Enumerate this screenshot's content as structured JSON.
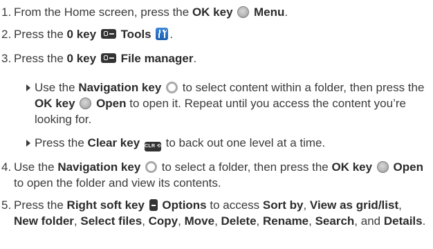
{
  "steps": [
    {
      "num": "1.",
      "a": "From the Home screen, press the ",
      "b1": "OK key",
      "c": " ",
      "b2": "Menu",
      "d": "."
    },
    {
      "num": "2.",
      "a": "Press the ",
      "b1": "0 key",
      "c": " ",
      "b2": "Tools",
      "d": "."
    },
    {
      "num": "3.",
      "a": "Press the ",
      "b1": "0 key",
      "c": " ",
      "b2": "File manager",
      "d": "."
    },
    {
      "num": "4.",
      "a": "Use the ",
      "b1": "Navigation key",
      "c": " to select a folder, then press the ",
      "b2": "OK key",
      "b3": "Open",
      "d": " to open the folder and view its contents."
    },
    {
      "num": "5.",
      "a": "Press the ",
      "b1": "Right soft key",
      "c": " ",
      "b2": "Options",
      "d": " to access ",
      "items": [
        "Sort by",
        "View as grid/list",
        "New folder",
        "Select files",
        "Copy",
        "Move",
        "Delete",
        "Rename",
        "Search",
        "Details"
      ],
      "sep": ", ",
      "and": " and ",
      "end": "."
    }
  ],
  "substeps": [
    {
      "a": "Use the ",
      "b1": "Navigation key",
      "c": " to select content within a folder, then press the ",
      "b2": "OK key",
      "b3": "Open",
      "d": " to open it. Repeat until you access the content you’re looking for."
    },
    {
      "a": "Press the ",
      "b1": "Clear key",
      "c": " to back out one level at a time."
    }
  ],
  "icons": {
    "ok": "ok-key-icon",
    "zero": "zero-key-icon",
    "tools": "tools-icon",
    "nav": "navigation-key-icon",
    "clear": "clear-key-icon",
    "clear_text": "CLR ⟲",
    "softkey": "right-soft-key-icon"
  }
}
